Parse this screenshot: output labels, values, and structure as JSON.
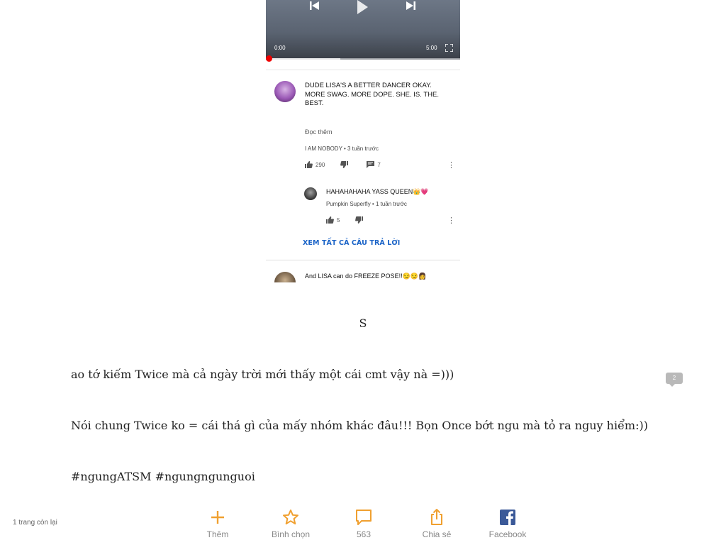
{
  "video": {
    "time_current": "0:00",
    "time_total": "5:00",
    "progress_fraction": 0.37
  },
  "comments": [
    {
      "text": "DUDE LISA'S A BETTER DANCER OKAY. MORE SWAG. MORE DOPE. SHE. IS. THE. BEST.",
      "read_more": "Đọc thêm",
      "meta": "I AM NOBODY • 3 tuần trước",
      "likes": "290",
      "replies": "7"
    },
    {
      "text": "HAHAHAHAHA YASS QUEEN👑💗",
      "meta": "Pumpkin Superfly • 1 tuần trước",
      "likes": "5"
    },
    {
      "text": "And LISA can do FREEZE POSE!!😏😏👩"
    }
  ],
  "see_all_replies": "XEM TẤT CẢ CÂU TRẢ LỜI",
  "article": {
    "center_letter": "S",
    "paragraphs": [
      "ao tớ kiếm Twice mà cả ngày trời mới thấy một cái cmt vậy nà =)))",
      "Nói chung Twice ko = cái thá gì của mấy nhóm khác đâu!!! Bọn Once bớt ngu mà tỏ ra nguy hiểm:))",
      "#ngungATSM #ngungngunguoi"
    ],
    "comment_badge": "2"
  },
  "bottom_bar": {
    "pages_left": "1 trang còn lại",
    "add_label": "Thêm",
    "vote_label": "Bình chọn",
    "comments_count": "563",
    "share_label": "Chia sẻ",
    "facebook_label": "Facebook"
  },
  "colors": {
    "accent": "#f0a030",
    "link_blue": "#1a63c7",
    "facebook": "#3b5998"
  }
}
